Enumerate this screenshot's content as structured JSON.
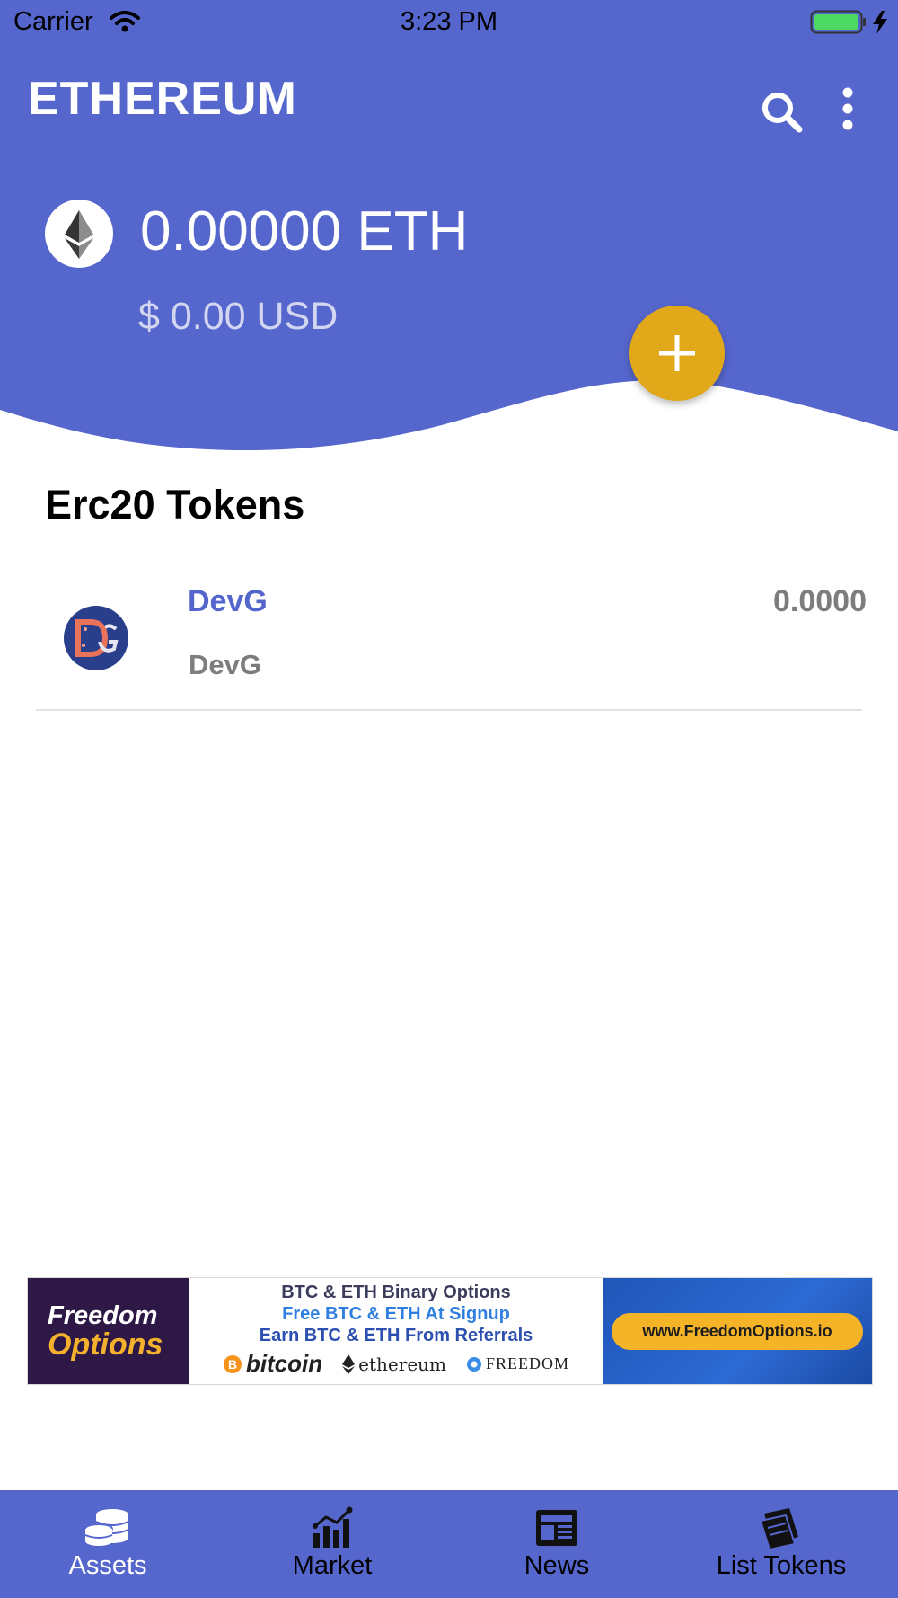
{
  "status_bar": {
    "carrier": "Carrier",
    "time": "3:23 PM"
  },
  "header": {
    "title": "ETHEREUM"
  },
  "balance": {
    "eth": "0.00000 ETH",
    "usd": "$ 0.00 USD"
  },
  "section": {
    "title": "Erc20 Tokens"
  },
  "tokens": [
    {
      "name": "DevG",
      "symbol": "DevG",
      "balance": "0.0000"
    }
  ],
  "ad": {
    "brand_line1": "Freedom",
    "brand_line2": "Options",
    "line1": "BTC & ETH Binary Options",
    "line2": "Free BTC & ETH At Signup",
    "line3": "Earn BTC & ETH From Referrals",
    "logo_bitcoin": "bitcoin",
    "logo_ethereum": "ethereum",
    "logo_freedom": "FREEDOM",
    "cta": "www.FreedomOptions.io"
  },
  "tabbar": {
    "items": [
      {
        "label": "Assets",
        "icon": "coins-icon",
        "active": true
      },
      {
        "label": "Market",
        "icon": "bar-chart-icon",
        "active": false
      },
      {
        "label": "News",
        "icon": "newspaper-icon",
        "active": false
      },
      {
        "label": "List Tokens",
        "icon": "tickets-icon",
        "active": false
      }
    ]
  },
  "colors": {
    "primary": "#5566CC",
    "accent": "#E1A91A",
    "token_name": "#5466CC",
    "muted_text": "#7D7D7D"
  }
}
